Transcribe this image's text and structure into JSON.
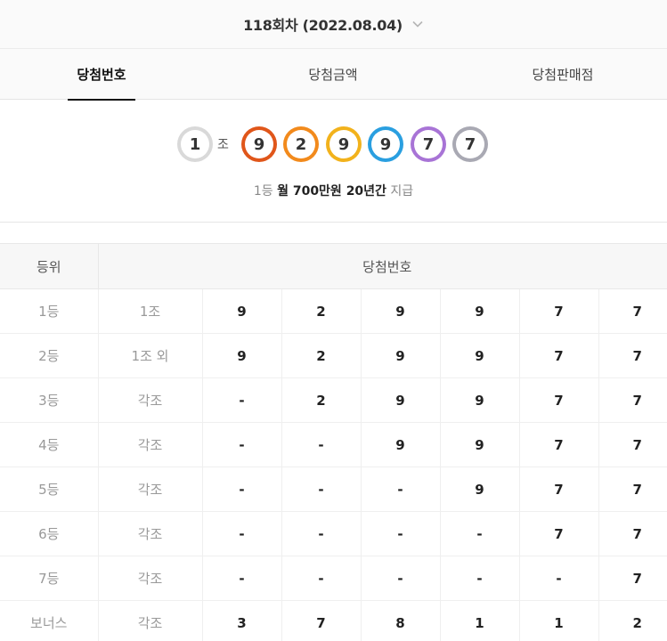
{
  "header": {
    "draw_title": "118회차 (2022.08.04)",
    "dropdown_icon": "chevron-down-icon"
  },
  "tabs": [
    {
      "label": "당첨번호",
      "active": true
    },
    {
      "label": "당첨금액",
      "active": false
    },
    {
      "label": "당첨판매점",
      "active": false
    }
  ],
  "winning": {
    "group": "1",
    "group_suffix": "조",
    "digits": [
      "9",
      "2",
      "9",
      "9",
      "7",
      "7"
    ],
    "colors": {
      "group": "#d9d9d9",
      "digits": [
        "#e0561a",
        "#f28a1c",
        "#f2b21c",
        "#2a9fe0",
        "#a874d6",
        "#a9a9b3"
      ]
    },
    "prize_prefix": "1등",
    "prize_bold": "월 700만원 20년간",
    "prize_suffix": "지급"
  },
  "table": {
    "headers": {
      "rank": "등위",
      "numbers": "당첨번호"
    },
    "rows": [
      {
        "rank": "1등",
        "group": "1조",
        "nums": [
          "9",
          "2",
          "9",
          "9",
          "7",
          "7"
        ]
      },
      {
        "rank": "2등",
        "group": "1조 외",
        "nums": [
          "9",
          "2",
          "9",
          "9",
          "7",
          "7"
        ]
      },
      {
        "rank": "3등",
        "group": "각조",
        "nums": [
          "-",
          "2",
          "9",
          "9",
          "7",
          "7"
        ]
      },
      {
        "rank": "4등",
        "group": "각조",
        "nums": [
          "-",
          "-",
          "9",
          "9",
          "7",
          "7"
        ]
      },
      {
        "rank": "5등",
        "group": "각조",
        "nums": [
          "-",
          "-",
          "-",
          "9",
          "7",
          "7"
        ]
      },
      {
        "rank": "6등",
        "group": "각조",
        "nums": [
          "-",
          "-",
          "-",
          "-",
          "7",
          "7"
        ]
      },
      {
        "rank": "7등",
        "group": "각조",
        "nums": [
          "-",
          "-",
          "-",
          "-",
          "-",
          "7"
        ]
      },
      {
        "rank": "보너스",
        "group": "각조",
        "nums": [
          "3",
          "7",
          "8",
          "1",
          "1",
          "2"
        ]
      }
    ]
  }
}
